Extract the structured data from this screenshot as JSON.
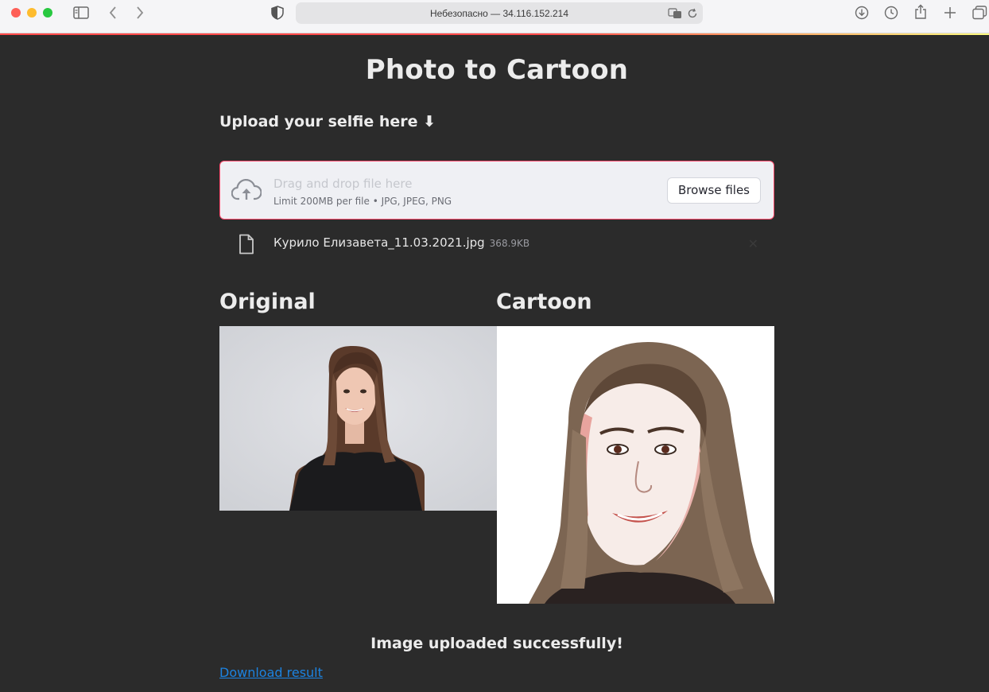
{
  "browser": {
    "url": "Небезопасно — 34.116.152.214"
  },
  "app": {
    "title": "Photo to Cartoon",
    "subheader": "Upload your selfie here ⬇",
    "uploader": {
      "primary_text": "Drag and drop file here",
      "secondary_text": "Limit 200MB per file • JPG, JPEG, PNG",
      "browse_label": "Browse files"
    },
    "uploaded_file": {
      "name": "Курило Елизавета_11.03.2021.jpg",
      "size": "368.9KB"
    },
    "columns": {
      "original_label": "Original",
      "cartoon_label": "Cartoon"
    },
    "status_message": "Image uploaded successfully!",
    "download_label": "Download result"
  },
  "colors": {
    "background": "#2b2b2b",
    "accent": "#ff4b4b",
    "link": "#1c83e1",
    "dropzone_bg": "#eff0f4"
  }
}
